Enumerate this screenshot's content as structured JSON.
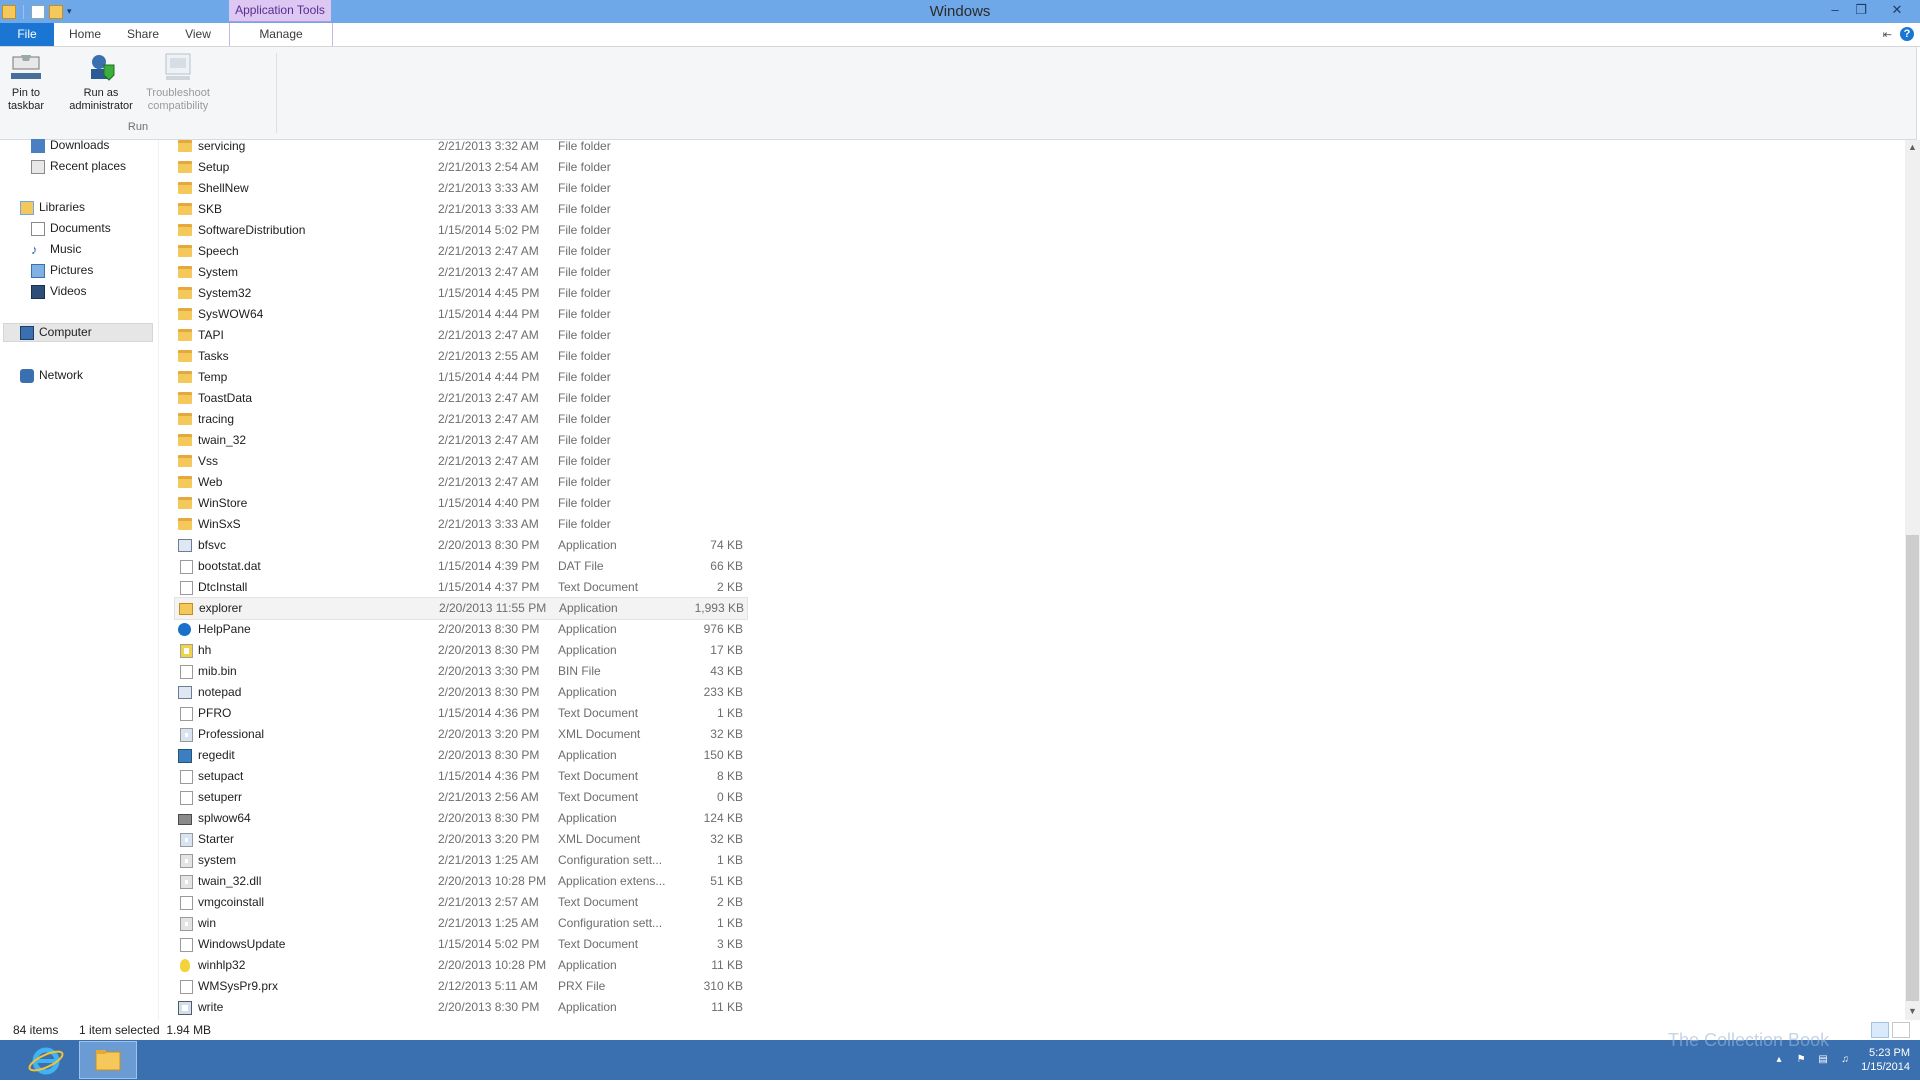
{
  "window": {
    "title": "Windows",
    "context_tab_header": "Application Tools",
    "controls": {
      "minimize": "–",
      "restore": "❐",
      "close": "✕"
    }
  },
  "ribbon": {
    "tabs": {
      "file": "File",
      "home": "Home",
      "share": "Share",
      "view": "View",
      "manage": "Manage"
    },
    "help": "?",
    "buttons": {
      "pin": "Pin to\ntaskbar",
      "runas": "Run as\nadministrator",
      "trouble": "Troubleshoot\ncompatibility"
    },
    "group_label": "Run"
  },
  "nav": {
    "downloads": "Downloads",
    "recent": "Recent places",
    "libraries": "Libraries",
    "documents": "Documents",
    "music": "Music",
    "pictures": "Pictures",
    "videos": "Videos",
    "computer": "Computer",
    "network": "Network"
  },
  "files": [
    {
      "name": "servicing",
      "date": "2/21/2013 3:32 AM",
      "type": "File folder",
      "size": "",
      "icon": "folder-icon"
    },
    {
      "name": "Setup",
      "date": "2/21/2013 2:54 AM",
      "type": "File folder",
      "size": "",
      "icon": "folder-icon"
    },
    {
      "name": "ShellNew",
      "date": "2/21/2013 3:33 AM",
      "type": "File folder",
      "size": "",
      "icon": "folder-icon"
    },
    {
      "name": "SKB",
      "date": "2/21/2013 3:33 AM",
      "type": "File folder",
      "size": "",
      "icon": "folder-icon"
    },
    {
      "name": "SoftwareDistribution",
      "date": "1/15/2014 5:02 PM",
      "type": "File folder",
      "size": "",
      "icon": "folder-icon"
    },
    {
      "name": "Speech",
      "date": "2/21/2013 2:47 AM",
      "type": "File folder",
      "size": "",
      "icon": "folder-icon"
    },
    {
      "name": "System",
      "date": "2/21/2013 2:47 AM",
      "type": "File folder",
      "size": "",
      "icon": "folder-icon"
    },
    {
      "name": "System32",
      "date": "1/15/2014 4:45 PM",
      "type": "File folder",
      "size": "",
      "icon": "folder-icon"
    },
    {
      "name": "SysWOW64",
      "date": "1/15/2014 4:44 PM",
      "type": "File folder",
      "size": "",
      "icon": "folder-icon"
    },
    {
      "name": "TAPI",
      "date": "2/21/2013 2:47 AM",
      "type": "File folder",
      "size": "",
      "icon": "folder-icon"
    },
    {
      "name": "Tasks",
      "date": "2/21/2013 2:55 AM",
      "type": "File folder",
      "size": "",
      "icon": "folder-icon"
    },
    {
      "name": "Temp",
      "date": "1/15/2014 4:44 PM",
      "type": "File folder",
      "size": "",
      "icon": "folder-icon"
    },
    {
      "name": "ToastData",
      "date": "2/21/2013 2:47 AM",
      "type": "File folder",
      "size": "",
      "icon": "folder-icon"
    },
    {
      "name": "tracing",
      "date": "2/21/2013 2:47 AM",
      "type": "File folder",
      "size": "",
      "icon": "folder-icon"
    },
    {
      "name": "twain_32",
      "date": "2/21/2013 2:47 AM",
      "type": "File folder",
      "size": "",
      "icon": "folder-icon"
    },
    {
      "name": "Vss",
      "date": "2/21/2013 2:47 AM",
      "type": "File folder",
      "size": "",
      "icon": "folder-icon"
    },
    {
      "name": "Web",
      "date": "2/21/2013 2:47 AM",
      "type": "File folder",
      "size": "",
      "icon": "folder-icon"
    },
    {
      "name": "WinStore",
      "date": "1/15/2014 4:40 PM",
      "type": "File folder",
      "size": "",
      "icon": "folder-icon"
    },
    {
      "name": "WinSxS",
      "date": "2/21/2013 3:33 AM",
      "type": "File folder",
      "size": "",
      "icon": "folder-icon"
    },
    {
      "name": "bfsvc",
      "date": "2/20/2013 8:30 PM",
      "type": "Application",
      "size": "74 KB",
      "icon": "app-icon"
    },
    {
      "name": "bootstat.dat",
      "date": "1/15/2014 4:39 PM",
      "type": "DAT File",
      "size": "66 KB",
      "icon": "document-icon"
    },
    {
      "name": "DtcInstall",
      "date": "1/15/2014 4:37 PM",
      "type": "Text Document",
      "size": "2 KB",
      "icon": "document-icon"
    },
    {
      "name": "explorer",
      "date": "2/20/2013 11:55 PM",
      "type": "Application",
      "size": "1,993 KB",
      "icon": "explorer-icon",
      "selected": true
    },
    {
      "name": "HelpPane",
      "date": "2/20/2013 8:30 PM",
      "type": "Application",
      "size": "976 KB",
      "icon": "help-icon"
    },
    {
      "name": "hh",
      "date": "2/20/2013 8:30 PM",
      "type": "Application",
      "size": "17 KB",
      "icon": "help-file-icon"
    },
    {
      "name": "mib.bin",
      "date": "2/20/2013 3:30 PM",
      "type": "BIN File",
      "size": "43 KB",
      "icon": "document-icon"
    },
    {
      "name": "notepad",
      "date": "2/20/2013 8:30 PM",
      "type": "Application",
      "size": "233 KB",
      "icon": "app-icon"
    },
    {
      "name": "PFRO",
      "date": "1/15/2014 4:36 PM",
      "type": "Text Document",
      "size": "1 KB",
      "icon": "document-icon"
    },
    {
      "name": "Professional",
      "date": "2/20/2013 3:20 PM",
      "type": "XML Document",
      "size": "32 KB",
      "icon": "xml-icon"
    },
    {
      "name": "regedit",
      "date": "2/20/2013 8:30 PM",
      "type": "Application",
      "size": "150 KB",
      "icon": "regedit-icon"
    },
    {
      "name": "setupact",
      "date": "1/15/2014 4:36 PM",
      "type": "Text Document",
      "size": "8 KB",
      "icon": "document-icon"
    },
    {
      "name": "setuperr",
      "date": "2/21/2013 2:56 AM",
      "type": "Text Document",
      "size": "0 KB",
      "icon": "document-icon"
    },
    {
      "name": "splwow64",
      "date": "2/20/2013 8:30 PM",
      "type": "Application",
      "size": "124 KB",
      "icon": "printer-icon"
    },
    {
      "name": "Starter",
      "date": "2/20/2013 3:20 PM",
      "type": "XML Document",
      "size": "32 KB",
      "icon": "xml-icon"
    },
    {
      "name": "system",
      "date": "2/21/2013 1:25 AM",
      "type": "Configuration sett...",
      "size": "1 KB",
      "icon": "config-icon"
    },
    {
      "name": "twain_32.dll",
      "date": "2/20/2013 10:28 PM",
      "type": "Application extens...",
      "size": "51 KB",
      "icon": "config-icon"
    },
    {
      "name": "vmgcoinstall",
      "date": "2/21/2013 2:57 AM",
      "type": "Text Document",
      "size": "2 KB",
      "icon": "document-icon"
    },
    {
      "name": "win",
      "date": "2/21/2013 1:25 AM",
      "type": "Configuration sett...",
      "size": "1 KB",
      "icon": "config-icon"
    },
    {
      "name": "WindowsUpdate",
      "date": "1/15/2014 5:02 PM",
      "type": "Text Document",
      "size": "3 KB",
      "icon": "document-icon"
    },
    {
      "name": "winhlp32",
      "date": "2/20/2013 10:28 PM",
      "type": "Application",
      "size": "11 KB",
      "icon": "bulb-icon"
    },
    {
      "name": "WMSysPr9.prx",
      "date": "2/12/2013 5:11 AM",
      "type": "PRX File",
      "size": "310 KB",
      "icon": "document-icon"
    },
    {
      "name": "write",
      "date": "2/20/2013 8:30 PM",
      "type": "Application",
      "size": "11 KB",
      "icon": "write-icon"
    }
  ],
  "status": {
    "items": "84 items",
    "selection": "1 item selected  1.94 MB"
  },
  "taskbar": {
    "watermark": "The Collection Book",
    "time": "5:23 PM",
    "date": "1/15/2014"
  },
  "colors": {
    "titlebar": "#6fa8e8",
    "file_tab": "#1a76d2",
    "taskbar": "#3a6fb0",
    "context_tab": "#dcc8f2"
  }
}
